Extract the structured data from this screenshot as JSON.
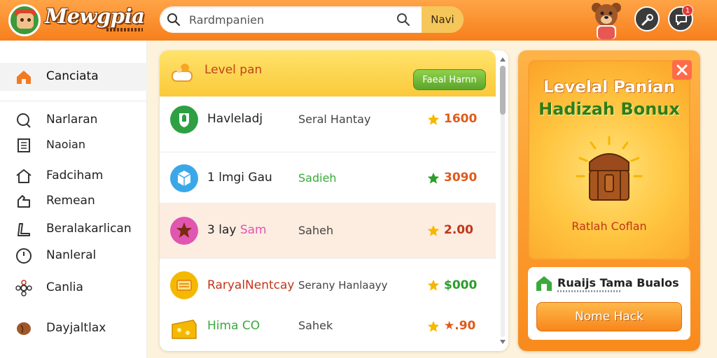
{
  "header": {
    "brand": "Mewgpia",
    "search_placeholder": "Rardmpanien",
    "search_button": "Navi",
    "notification_count": "1"
  },
  "sidebar": {
    "items": [
      {
        "label": "Canciata",
        "icon": "home-icon",
        "active": true
      },
      {
        "label": "Narlaran",
        "icon": "search-icon"
      },
      {
        "label": "Naoian",
        "icon": "document-icon"
      },
      {
        "label": "Fadciham",
        "icon": "house-outline-icon"
      },
      {
        "label": "Remean",
        "icon": "puzzle-icon"
      },
      {
        "label": "Beralakarlican",
        "icon": "tag-icon"
      },
      {
        "label": "Nanleral",
        "icon": "clock-icon"
      },
      {
        "label": "Canlia",
        "icon": "flower-icon"
      },
      {
        "label": "Dayjaltlax",
        "icon": "bean-icon"
      }
    ]
  },
  "list": {
    "header_title": "Level pan",
    "header_button": "Faeal Harnn",
    "rows": [
      {
        "name": "Havleladj",
        "sub": "Seral Hantay",
        "value": "1600",
        "value_color": "#e05a1a",
        "star_color": "#f5b800",
        "icon_color": "#2ea043"
      },
      {
        "name": "1 lmgi Gau",
        "sub": "Sadieh",
        "value": "3090",
        "value_color": "#e05a1a",
        "star_color": "#2a9d2a",
        "icon_color": "#3aa8e8",
        "sub_color": "#3aaa3a"
      },
      {
        "name": "3 lay",
        "name_accent": "Sam",
        "sub": "Saheh",
        "value": "2.00",
        "value_color": "#c0361a",
        "star_color": "#f5b800",
        "icon_color": "#e056b0"
      },
      {
        "name": "RaryalNentcay",
        "sub": "Serany Hanlaayy",
        "value": "$000",
        "value_color": "#2a9d2a",
        "star_color": "#f5b800",
        "icon_color": "#f5b800",
        "name_color": "#c0361a"
      },
      {
        "name": "Hima CO",
        "sub": "Sahek",
        "value": "★.90",
        "value_color": "#e05a1a",
        "star_color": "#f5b800",
        "icon_color": "#f5b800",
        "name_color": "#3aaa3a"
      }
    ]
  },
  "promo": {
    "title1": "Levelal Panian",
    "title2": "Hadizah Bonux",
    "caption": "Ratlah Coflan",
    "card_text": "Ruaijs Tama Bualos",
    "card_button": "Nome Hack"
  }
}
